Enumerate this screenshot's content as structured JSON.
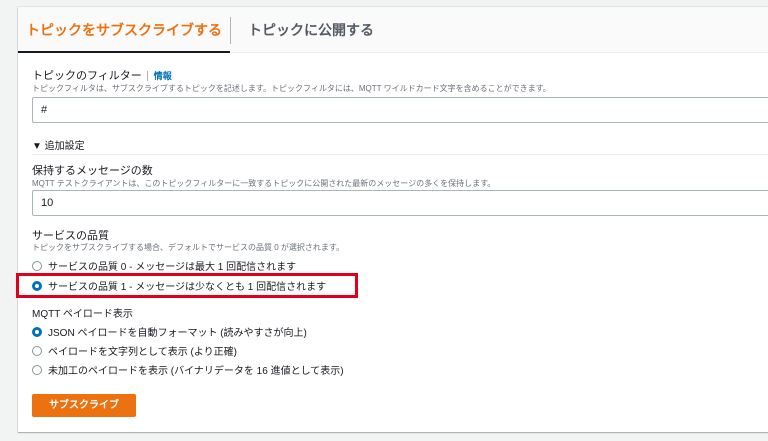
{
  "tabs": [
    "トピックをサブスクライブする",
    "トピックに公開する"
  ],
  "filter": {
    "label": "トピックのフィルター",
    "info": "情報",
    "desc": "トピックフィルタは、サブスクライブするトピックを記述します。トピックフィルタには、MQTT ワイルドカード文字を含めることができます。",
    "value": "#"
  },
  "additional": {
    "label": "▼ 追加設定"
  },
  "retain": {
    "label": "保持するメッセージの数",
    "desc": "MQTT テストクライアントは、このトピックフィルターに一致するトピックに公開された最新のメッセージの多くを保持します。",
    "value": "10"
  },
  "qos": {
    "label": "サービスの品質",
    "desc": "トピックをサブスクライブする場合、デフォルトでサービスの品質 0 が選択されます。",
    "options": [
      "サービスの品質 0 - メッセージは最大 1 回配信されます",
      "サービスの品質 1 - メッセージは少なくとも 1 回配信されます"
    ],
    "selected": 1
  },
  "payload": {
    "label": "MQTT ペイロード表示",
    "options": [
      "JSON ペイロードを自動フォーマット (読みやすさが向上)",
      "ペイロードを文字列として表示 (より正確)",
      "未加工のペイロードを表示 (バイナリデータを 16 進値として表示)"
    ],
    "selected": 0
  },
  "subscribe_button": "サブスクライブ"
}
